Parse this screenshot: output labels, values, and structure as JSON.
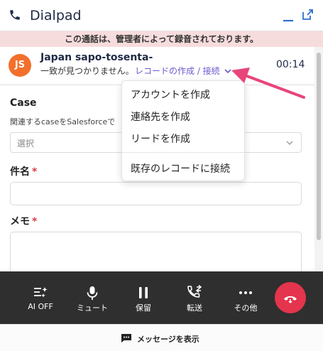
{
  "app": {
    "title": "Dialpad",
    "recording_notice": "この通話は、管理者によって録音されております。"
  },
  "call": {
    "avatar_initials": "JS",
    "caller_name": "Japan sapo-tosenta-",
    "no_match_text": "一致が見つかりません。",
    "record_link": "レコードの作成 / 接続",
    "timer": "00:14"
  },
  "form": {
    "case_label": "Case",
    "case_hint": "関連するcaseをSalesforceで",
    "case_placeholder": "選択",
    "subject_label": "件名",
    "memo_label": "メモ",
    "required_mark": "*"
  },
  "menu": {
    "items": [
      "アカウントを作成",
      "連絡先を作成",
      "リードを作成",
      "既存のレコードに接続"
    ]
  },
  "toolbar": {
    "ai_off": "AI OFF",
    "mute": "ミュート",
    "hold": "保留",
    "transfer": "転送",
    "more": "その他"
  },
  "footer": {
    "show_messages": "メッセージを表示"
  },
  "colors": {
    "avatar": "#f2702b",
    "banner": "#f7dcdd",
    "link": "#6a5acd",
    "hangup": "#e5344d",
    "annotation_arrow": "#e8457a"
  }
}
